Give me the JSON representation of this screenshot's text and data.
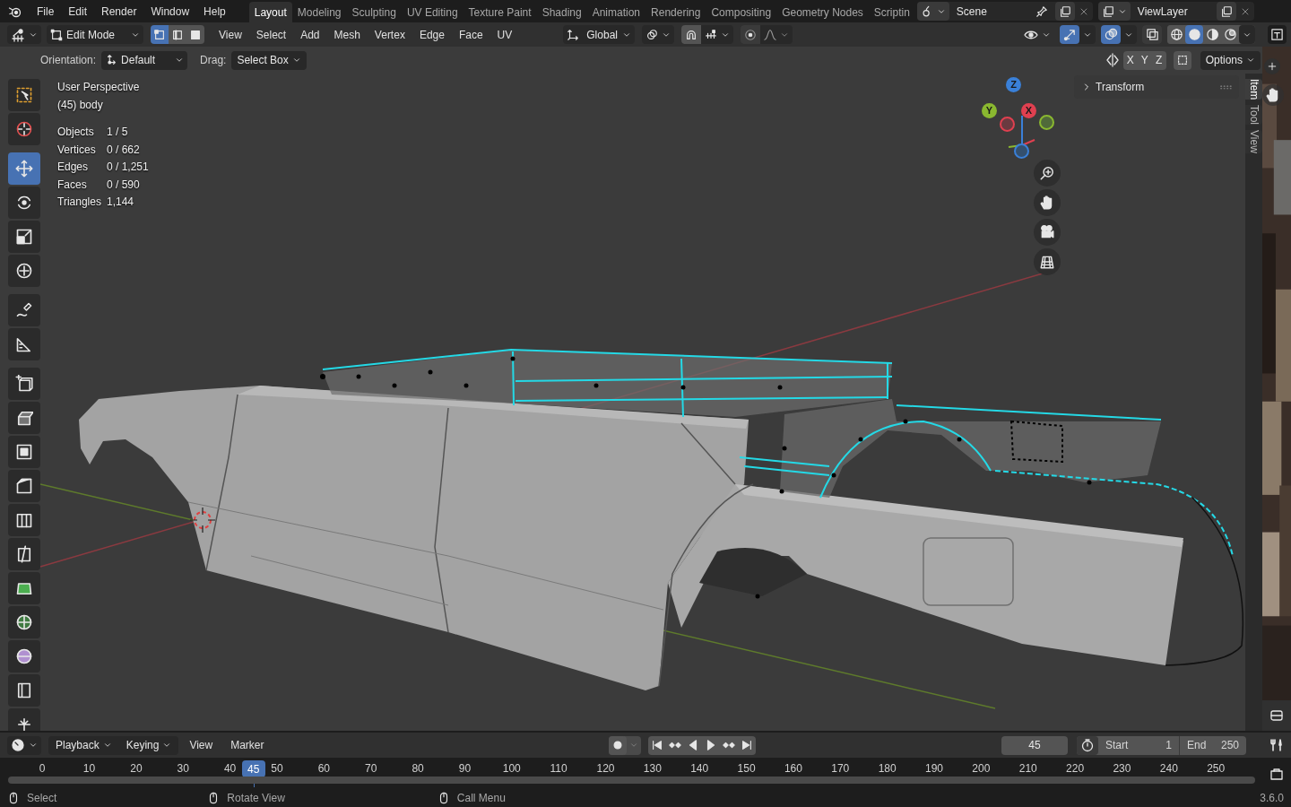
{
  "menu_bar": [
    "File",
    "Edit",
    "Render",
    "Window",
    "Help"
  ],
  "workspace_tabs": [
    {
      "label": "Layout",
      "selected": true
    },
    {
      "label": "Modeling",
      "selected": false
    },
    {
      "label": "Sculpting",
      "selected": false
    },
    {
      "label": "UV Editing",
      "selected": false
    },
    {
      "label": "Texture Paint",
      "selected": false
    },
    {
      "label": "Shading",
      "selected": false
    },
    {
      "label": "Animation",
      "selected": false
    },
    {
      "label": "Rendering",
      "selected": false
    },
    {
      "label": "Compositing",
      "selected": false
    },
    {
      "label": "Geometry Nodes",
      "selected": false
    },
    {
      "label": "Scriptin",
      "selected": false
    }
  ],
  "scene": "Scene",
  "view_layer": "ViewLayer",
  "header": {
    "mode": "Edit Mode",
    "select_modes": [
      {
        "kind": "vertex",
        "selected": true
      },
      {
        "kind": "edge",
        "selected": false
      },
      {
        "kind": "face",
        "selected": false
      }
    ],
    "menus": [
      "View",
      "Select",
      "Add",
      "Mesh",
      "Vertex",
      "Edge",
      "Face",
      "UV"
    ],
    "orientation": "Global",
    "snap_on": false,
    "proportional_on": false,
    "toggles": [
      {
        "kind": "gizmo",
        "on": true
      },
      {
        "kind": "overlay",
        "on": true
      },
      {
        "kind": "xray",
        "on": false
      }
    ],
    "shading": [
      {
        "kind": "wireframe",
        "selected": false
      },
      {
        "kind": "solid",
        "selected": true
      },
      {
        "kind": "material",
        "selected": false
      },
      {
        "kind": "rendered",
        "selected": false
      }
    ]
  },
  "tool_settings": {
    "orientation_label": "Orientation:",
    "orientation": "Default",
    "drag_label": "Drag:",
    "drag": "Select Box",
    "axes": [
      "X",
      "Y",
      "Z"
    ],
    "options": "Options"
  },
  "toolbar": [
    {
      "kind": "select",
      "selected": false
    },
    {
      "kind": "cursor",
      "selected": false
    },
    {
      "kind": "move",
      "selected": true
    },
    {
      "kind": "rotate",
      "selected": false
    },
    {
      "kind": "scale",
      "selected": false
    },
    {
      "kind": "transform",
      "selected": false
    },
    {
      "kind": "annotate",
      "selected": false
    },
    {
      "kind": "measure",
      "selected": false
    },
    {
      "kind": "add-cube",
      "selected": false
    },
    {
      "kind": "extrude",
      "selected": false
    },
    {
      "kind": "inset",
      "selected": false
    },
    {
      "kind": "bevel",
      "selected": false
    },
    {
      "kind": "loop-cut",
      "selected": false
    },
    {
      "kind": "knife",
      "selected": false
    },
    {
      "kind": "poly-build",
      "selected": false
    },
    {
      "kind": "spin",
      "selected": false
    },
    {
      "kind": "smooth",
      "selected": false
    },
    {
      "kind": "edge-slide",
      "selected": false
    },
    {
      "kind": "shrink",
      "selected": false
    }
  ],
  "viewport": {
    "view_name": "User Perspective",
    "object_label": "(45) body",
    "stats": [
      {
        "label": "Objects",
        "value": "1 / 5"
      },
      {
        "label": "Vertices",
        "value": "0 / 662"
      },
      {
        "label": "Edges",
        "value": "0 / 1,251"
      },
      {
        "label": "Faces",
        "value": "0 / 590"
      },
      {
        "label": "Triangles",
        "value": "1,144"
      }
    ],
    "gizmo_axes": [
      "Z",
      "Y",
      "X"
    ],
    "panel": {
      "title": "Transform",
      "expanded": false
    }
  },
  "sidebar_tabs": [
    {
      "label": "Item",
      "selected": true
    },
    {
      "label": "Tool",
      "selected": false
    },
    {
      "label": "View",
      "selected": false
    }
  ],
  "timeline": {
    "menus": [
      "Playback",
      "Keying",
      "View",
      "Marker"
    ],
    "current_frame": "45",
    "start_label": "Start",
    "start": "1",
    "end_label": "End",
    "end": "250",
    "ruler": [
      {
        "kind": "tick",
        "label": "0"
      },
      {
        "kind": "tick",
        "label": "10"
      },
      {
        "kind": "tick",
        "label": "20"
      },
      {
        "kind": "tick",
        "label": "30"
      },
      {
        "kind": "tick",
        "label": "40"
      },
      {
        "kind": "current",
        "label": "45"
      },
      {
        "kind": "tick",
        "label": "50"
      },
      {
        "kind": "tick",
        "label": "60"
      },
      {
        "kind": "tick",
        "label": "70"
      },
      {
        "kind": "tick",
        "label": "80"
      },
      {
        "kind": "tick",
        "label": "90"
      },
      {
        "kind": "tick",
        "label": "100"
      },
      {
        "kind": "tick",
        "label": "110"
      },
      {
        "kind": "tick",
        "label": "120"
      },
      {
        "kind": "tick",
        "label": "130"
      },
      {
        "kind": "tick",
        "label": "140"
      },
      {
        "kind": "tick",
        "label": "150"
      },
      {
        "kind": "tick",
        "label": "160"
      },
      {
        "kind": "tick",
        "label": "170"
      },
      {
        "kind": "tick",
        "label": "180"
      },
      {
        "kind": "tick",
        "label": "190"
      },
      {
        "kind": "tick",
        "label": "200"
      },
      {
        "kind": "tick",
        "label": "210"
      },
      {
        "kind": "tick",
        "label": "220"
      },
      {
        "kind": "tick",
        "label": "230"
      },
      {
        "kind": "tick",
        "label": "240"
      },
      {
        "kind": "tick",
        "label": "250"
      }
    ]
  },
  "status_bar": {
    "hints": [
      "Select",
      "Rotate View",
      "Call Menu"
    ],
    "version": "3.6.0"
  }
}
